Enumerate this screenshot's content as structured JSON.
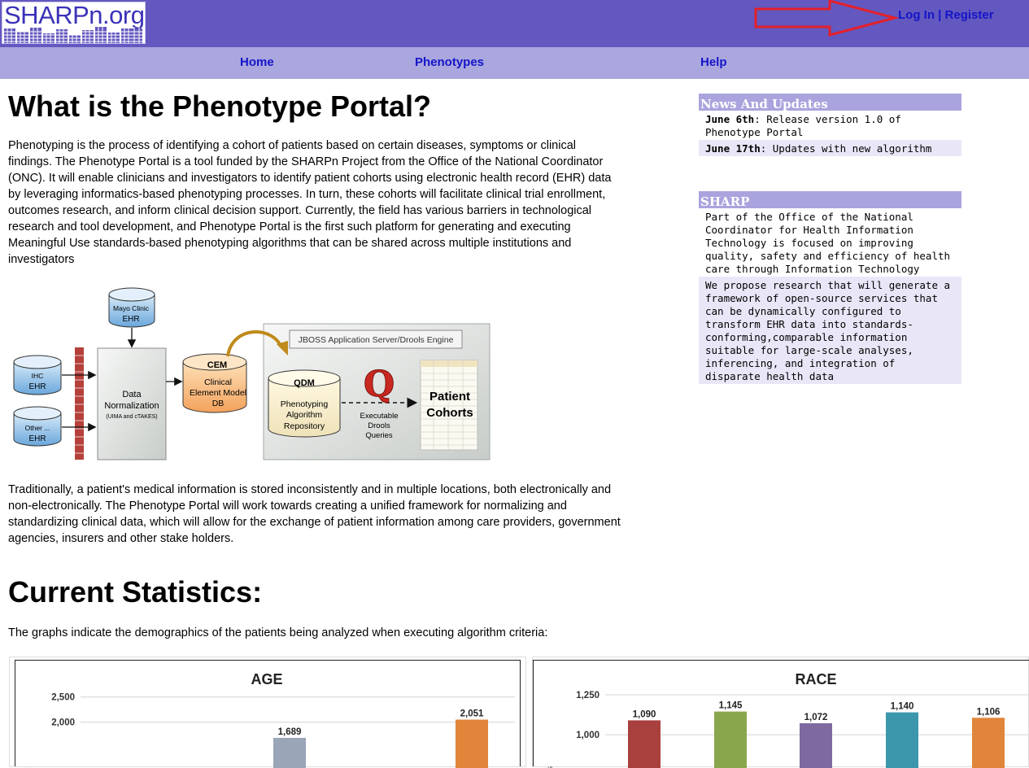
{
  "header": {
    "logo_text": "SHARPn.org",
    "login": "Log In",
    "separator": "|",
    "register": "Register"
  },
  "nav": {
    "home": "Home",
    "phenotypes": "Phenotypes",
    "help": "Help"
  },
  "main": {
    "title": "What is the Phenotype Portal?",
    "intro": "Phenotyping is the process of identifying a cohort of patients based on certain diseases, symptoms or clinical findings. The Phenotype Portal is a tool funded by the SHARPn Project from the Office of the National Coordinator (ONC). It will enable clinicians and investigators to identify patient cohorts using electronic health record (EHR) data by leveraging informatics-based phenotyping processes. In turn, these cohorts will facilitate clinical trial enrollment, outcomes research, and inform clinical decision support. Currently, the field has various barriers in technological research and tool development, and Phenotype Portal is the first such platform for generating and executing Meaningful Use standards-based phenotyping algorithms that can be shared across multiple institutions and investigators",
    "para2": "Traditionally, a patient's medical information is stored inconsistently and in multiple locations, both electronically and non-electronically. The Phenotype Portal will work towards creating a unified framework for normalizing and standardizing clinical data, which will allow for the exchange of patient information among care providers, government agencies, insurers and other stake holders.",
    "stats_title": "Current Statistics:",
    "stats_intro": "The graphs indicate the demographics of the patients being analyzed when executing algorithm criteria:"
  },
  "diagram": {
    "mayo": "Mayo Clinic",
    "ehr": "EHR",
    "ihc": "IHC",
    "other": "Other ...",
    "data_norm_1": "Data",
    "data_norm_2": "Normalization",
    "data_norm_3": "(UIMA and cTAKES)",
    "cem": "CEM",
    "cem_1": "Clinical",
    "cem_2": "Element Model",
    "cem_3": "DB",
    "jboss": "JBOSS Application Server/Drools Engine",
    "qdm": "QDM",
    "qdm_1": "Phenotyping",
    "qdm_2": "Algorithm",
    "qdm_3": "Repository",
    "exec_1": "Executable",
    "exec_2": "Drools",
    "exec_3": "Queries",
    "q_letter": "Q",
    "cohorts_1": "Patient",
    "cohorts_2": "Cohorts"
  },
  "sidebar": {
    "news": {
      "title": "News And Updates",
      "items": [
        {
          "date": "June 6th",
          "text": ": Release version 1.0 of Phenotype Portal"
        },
        {
          "date": "June 17th",
          "text": ": Updates with new algorithm"
        }
      ]
    },
    "sharp": {
      "title": "SHARP",
      "items": [
        "Part of the Office of the National Coordinator for Health Information Technology is focused on improving quality, safety and efficiency of health care through Information Technology",
        "We propose research that will generate a framework of open-source services that can be dynamically configured to transform EHR data into standards-conforming,comparable information suitable for large-scale analyses, inferencing, and integration of disparate health data"
      ]
    }
  },
  "colors": {
    "header_bg": "#6358bf",
    "nav_bg": "#aaa6de",
    "link": "#1515c9"
  },
  "chart_data": [
    {
      "type": "bar",
      "title": "AGE",
      "ytick_labels": [
        "2,500",
        "2,000"
      ],
      "yticks": [
        2500,
        2000
      ],
      "ylim_visible": [
        1640,
        2560
      ],
      "bars": [
        {
          "value": 1689,
          "label": "1,689",
          "color": "#9aa5b8"
        },
        {
          "value": 2051,
          "label": "2,051",
          "color": "#e0853a"
        }
      ],
      "ylabel_fragment": "s"
    },
    {
      "type": "bar",
      "title": "RACE",
      "ytick_labels": [
        "1,250",
        "1,000"
      ],
      "yticks": [
        1250,
        1000
      ],
      "ylim_visible": [
        960,
        1260
      ],
      "bars": [
        {
          "value": 1090,
          "label": "1,090",
          "color": "#a8403e"
        },
        {
          "value": 1145,
          "label": "1,145",
          "color": "#8aa64c"
        },
        {
          "value": 1072,
          "label": "1,072",
          "color": "#7e6aa0"
        },
        {
          "value": 1140,
          "label": "1,140",
          "color": "#3c97ad"
        },
        {
          "value": 1106,
          "label": "1,106",
          "color": "#e0853a"
        }
      ],
      "ylabel_fragment": "rs"
    }
  ]
}
